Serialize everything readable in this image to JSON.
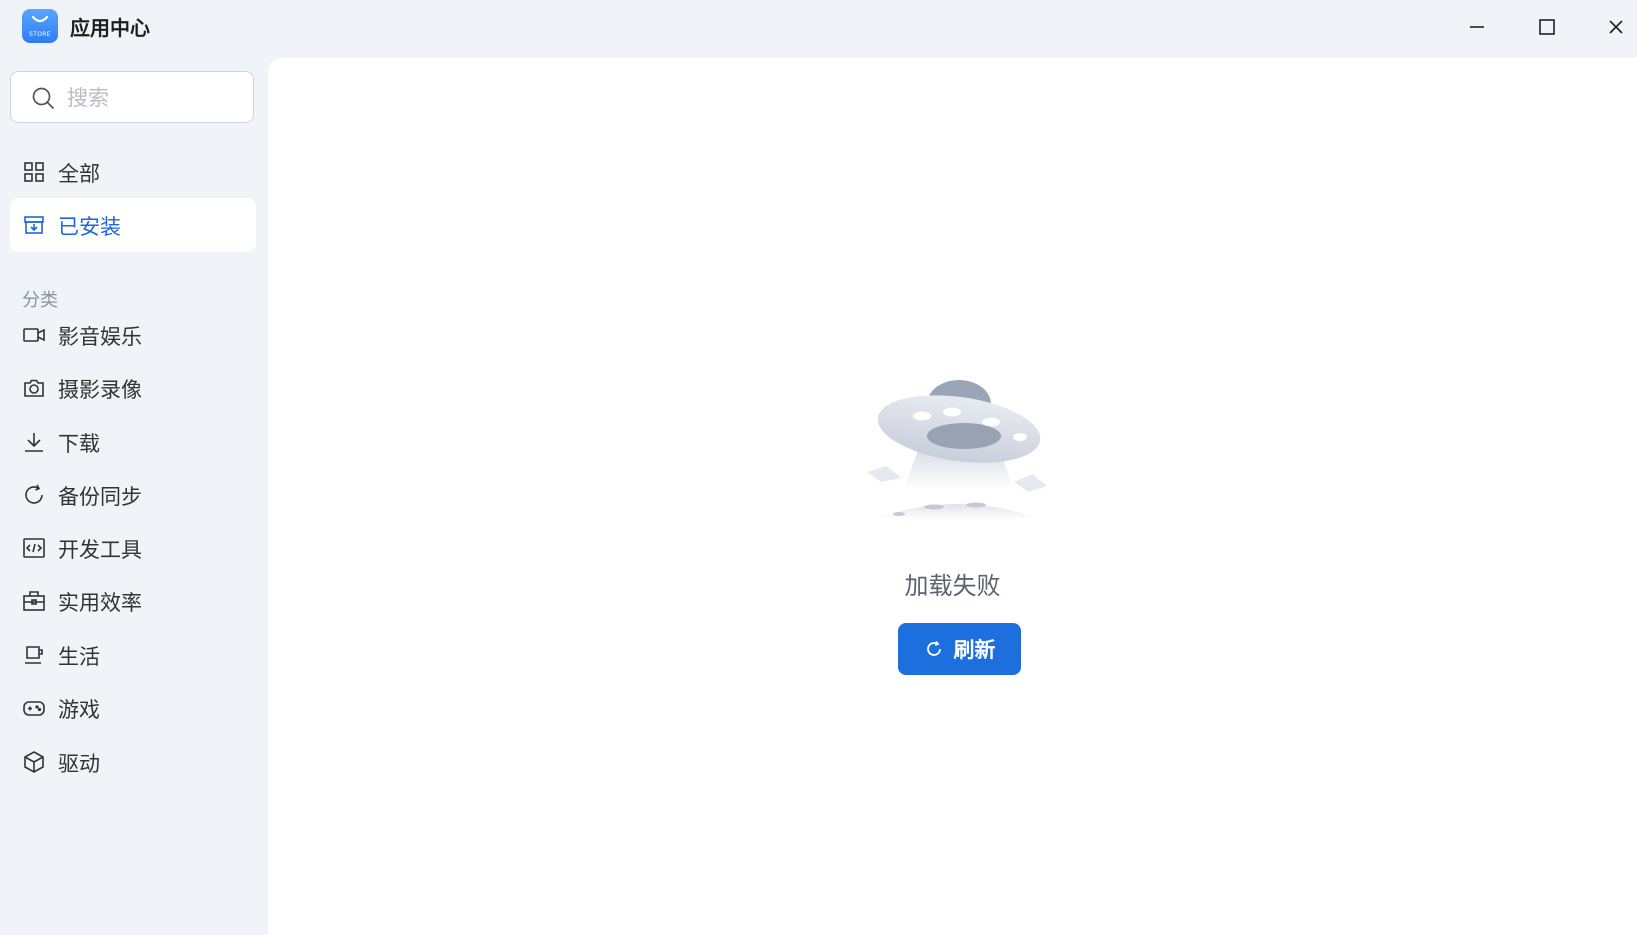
{
  "app": {
    "title": "应用中心",
    "logo_text": "STORE"
  },
  "window_controls": {
    "minimize_icon": "minimize-icon",
    "maximize_icon": "maximize-icon",
    "close_icon": "close-icon"
  },
  "search": {
    "placeholder": "搜索",
    "value": ""
  },
  "nav": {
    "items": [
      {
        "label": "全部",
        "icon": "grid-icon",
        "active": false
      },
      {
        "label": "已安装",
        "icon": "installed-box-icon",
        "active": true
      }
    ]
  },
  "categories": {
    "section_label": "分类",
    "items": [
      {
        "label": "影音娱乐",
        "icon": "video-camera-icon"
      },
      {
        "label": "摄影录像",
        "icon": "camera-icon"
      },
      {
        "label": "下载",
        "icon": "download-icon"
      },
      {
        "label": "备份同步",
        "icon": "sync-icon"
      },
      {
        "label": "开发工具",
        "icon": "code-icon"
      },
      {
        "label": "实用效率",
        "icon": "toolbox-icon"
      },
      {
        "label": "生活",
        "icon": "coffee-cup-icon"
      },
      {
        "label": "游戏",
        "icon": "gamepad-icon"
      },
      {
        "label": "驱动",
        "icon": "cube-icon"
      }
    ]
  },
  "main": {
    "illustration": "ufo-illustration",
    "error_text": "加载失败",
    "refresh_label": "刷新"
  },
  "colors": {
    "accent": "#1e6fde",
    "active_text": "#1d66d9",
    "sidebar_bg": "#f0f3f8"
  }
}
